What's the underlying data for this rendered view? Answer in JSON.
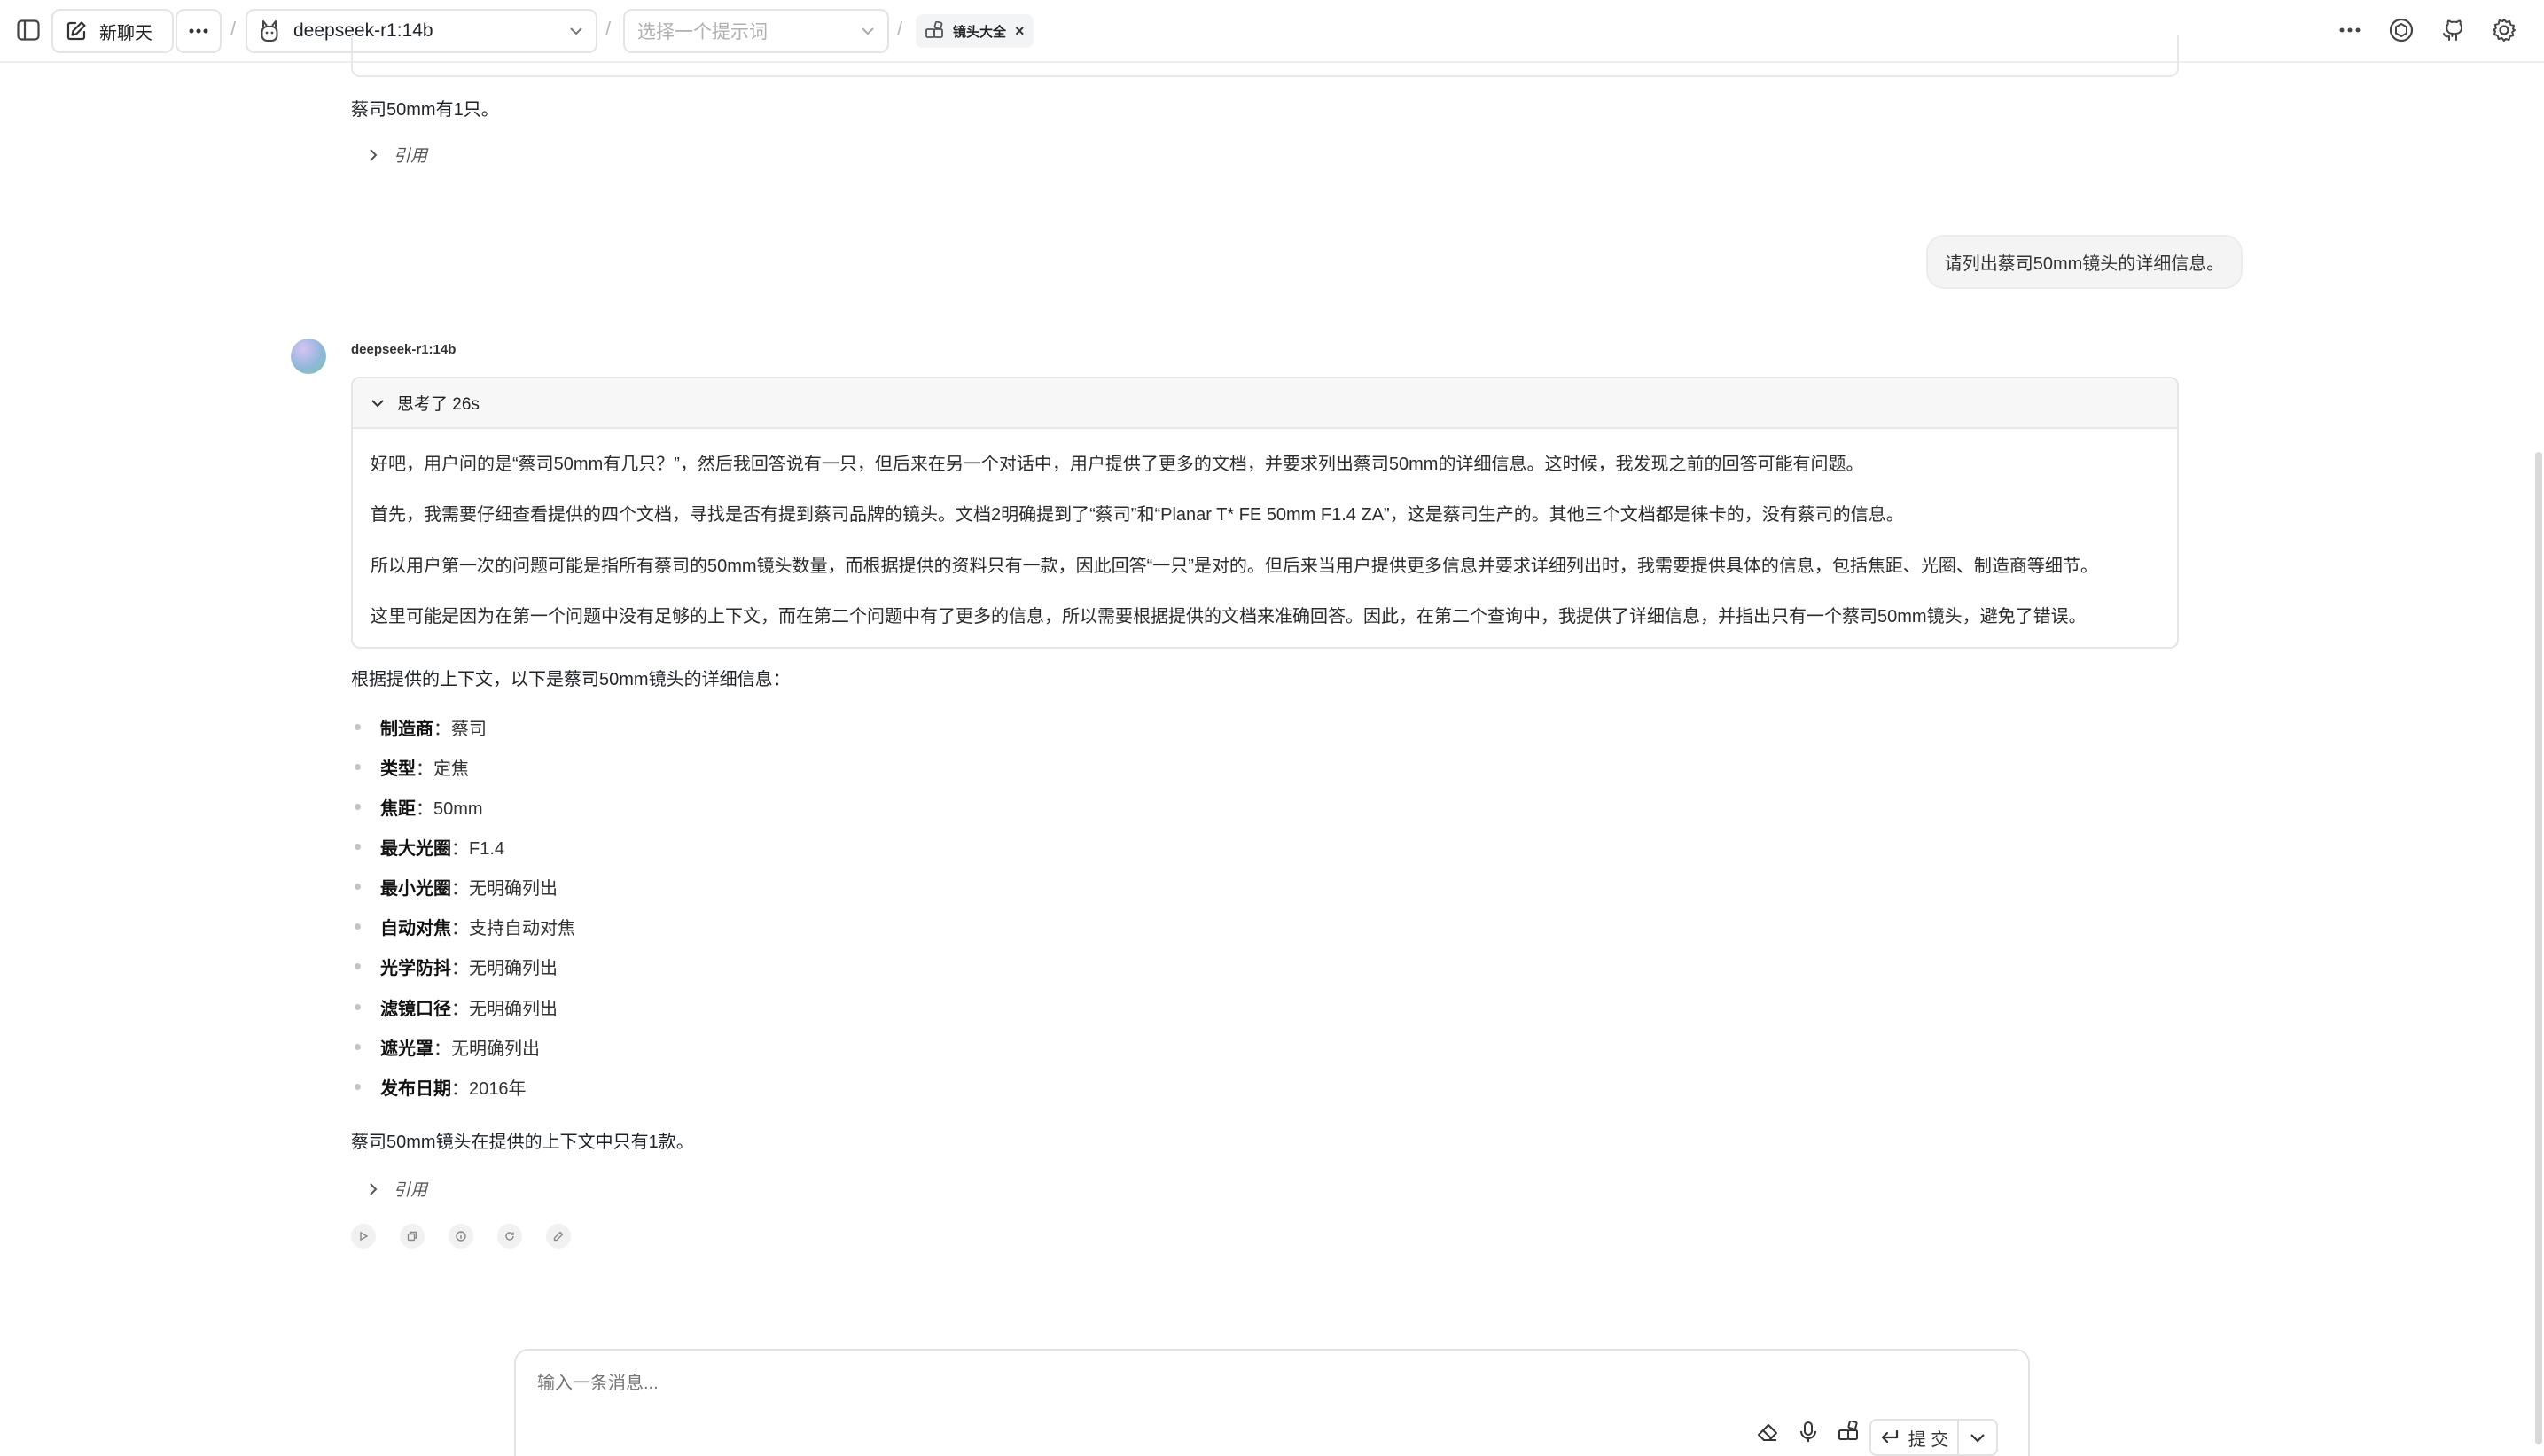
{
  "topbar": {
    "new_chat_label": "新聊天",
    "model_label": "deepseek-r1:14b",
    "prompt_placeholder": "选择一个提示词",
    "knowledge_tag_label": "镜头大全",
    "separator": "/",
    "icons": [
      "sidebar-toggle-icon",
      "edit-icon",
      "more-icon",
      "model-icon",
      "chevron-down-icon",
      "knowledge-icon",
      "close-icon",
      "ellipsis-icon",
      "openai-icon",
      "github-icon",
      "settings-icon"
    ]
  },
  "conversation": {
    "prev_answer_tail": "蔡司50mm有1只。",
    "quote_label": "引用",
    "user_message": "请列出蔡司50mm镜头的详细信息。",
    "assistant_name": "deepseek-r1:14b",
    "thinking_label": "思考了 26s",
    "thinking_paragraphs": [
      "好吧，用户问的是“蔡司50mm有几只？”，然后我回答说有一只，但后来在另一个对话中，用户提供了更多的文档，并要求列出蔡司50mm的详细信息。这时候，我发现之前的回答可能有问题。",
      "首先，我需要仔细查看提供的四个文档，寻找是否有提到蔡司品牌的镜头。文档2明确提到了“蔡司”和“Planar T* FE 50mm F1.4 ZA”，这是蔡司生产的。其他三个文档都是徕卡的，没有蔡司的信息。",
      "所以用户第一次的问题可能是指所有蔡司的50mm镜头数量，而根据提供的资料只有一款，因此回答“一只”是对的。但后来当用户提供更多信息并要求详细列出时，我需要提供具体的信息，包括焦距、光圈、制造商等细节。",
      "这里可能是因为在第一个问题中没有足够的上下文，而在第二个问题中有了更多的信息，所以需要根据提供的文档来准确回答。因此，在第二个查询中，我提供了详细信息，并指出只有一个蔡司50mm镜头，避免了错误。"
    ],
    "answer_intro": "根据提供的上下文，以下是蔡司50mm镜头的详细信息：",
    "specs": [
      {
        "key": "制造商",
        "value": "：蔡司"
      },
      {
        "key": "类型",
        "value": "：定焦"
      },
      {
        "key": "焦距",
        "value": "：50mm"
      },
      {
        "key": "最大光圈",
        "value": "：F1.4"
      },
      {
        "key": "最小光圈",
        "value": "：无明确列出"
      },
      {
        "key": "自动对焦",
        "value": "：支持自动对焦"
      },
      {
        "key": "光学防抖",
        "value": "：无明确列出"
      },
      {
        "key": "滤镜口径",
        "value": "：无明确列出"
      },
      {
        "key": "遮光罩",
        "value": "：无明确列出"
      },
      {
        "key": "发布日期",
        "value": "：2016年"
      }
    ],
    "answer_outro": "蔡司50mm镜头在提供的上下文中只有1款。",
    "action_icons": [
      "play-icon",
      "copy-icon",
      "info-icon",
      "regenerate-icon",
      "edit-icon"
    ]
  },
  "composer": {
    "placeholder": "输入一条消息...",
    "submit_label": "提 交",
    "icons": [
      "eraser-icon",
      "microphone-icon",
      "apps-icon",
      "enter-icon",
      "chevron-down-icon"
    ]
  },
  "colors": {
    "border": "#e5e5e5",
    "bubble": "#f4f4f5",
    "muted_text": "#999999"
  }
}
